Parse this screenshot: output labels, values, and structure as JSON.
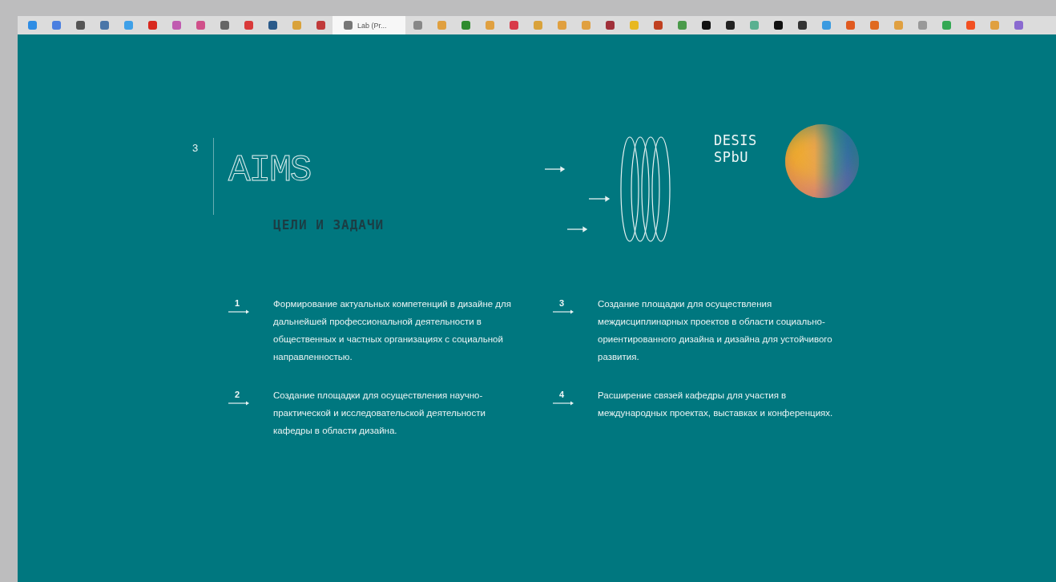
{
  "browser": {
    "tabs": [
      {
        "color": "#2f8de4",
        "selected": false
      },
      {
        "color": "#4a7fe0",
        "selected": false
      },
      {
        "color": "#555555",
        "selected": false
      },
      {
        "color": "#4a76a8",
        "selected": false
      },
      {
        "color": "#3ea0e8",
        "selected": false
      },
      {
        "color": "#d8281e",
        "selected": false
      },
      {
        "color": "#c05bb0",
        "selected": false
      },
      {
        "color": "#d0508a",
        "selected": false
      },
      {
        "color": "#666666",
        "selected": false
      },
      {
        "color": "#d93a3a",
        "selected": false
      },
      {
        "color": "#2a5a8a",
        "selected": false
      },
      {
        "color": "#d9a23a",
        "selected": false
      },
      {
        "color": "#c03a3a",
        "selected": false
      },
      {
        "label": "Lab (Pr...",
        "color": "#777777",
        "selected": true
      },
      {
        "color": "#888888",
        "selected": false
      },
      {
        "color": "#e0a040",
        "selected": false
      },
      {
        "color": "#2e8b2e",
        "selected": false
      },
      {
        "color": "#e0a040",
        "selected": false
      },
      {
        "color": "#d83a4a",
        "selected": false
      },
      {
        "color": "#d9a23a",
        "selected": false
      },
      {
        "color": "#e0a040",
        "selected": false
      },
      {
        "color": "#e0a040",
        "selected": false
      },
      {
        "color": "#a0303a",
        "selected": false
      },
      {
        "color": "#e8b820",
        "selected": false
      },
      {
        "color": "#c04020",
        "selected": false
      },
      {
        "color": "#4a9a4a",
        "selected": false
      },
      {
        "color": "#111111",
        "selected": false
      },
      {
        "color": "#222222",
        "selected": false
      },
      {
        "color": "#5ab090",
        "selected": false
      },
      {
        "color": "#101010",
        "selected": false
      },
      {
        "color": "#333333",
        "selected": false
      },
      {
        "color": "#3a9ae0",
        "selected": false
      },
      {
        "color": "#e05a20",
        "selected": false
      },
      {
        "color": "#e06a20",
        "selected": false
      },
      {
        "color": "#e0a040",
        "selected": false
      },
      {
        "color": "#999999",
        "selected": false
      },
      {
        "color": "#34a853",
        "selected": false
      },
      {
        "color": "#f25022",
        "selected": false
      },
      {
        "color": "#e0a040",
        "selected": false
      },
      {
        "color": "#8a6ad0",
        "selected": false
      }
    ]
  },
  "slide": {
    "number": "3",
    "title": "AIMS",
    "subtitle": "ЦЕЛИ И ЗАДАЧИ",
    "brand": [
      "DESIS",
      "SPbU"
    ],
    "aims": [
      {
        "number": "1",
        "text": "Формирование  актуальных компетенций в дизайне для дальнейшей профессиональной деятельности в общественных и частных организациях с социальной направленностью."
      },
      {
        "number": "3",
        "text": "Создание площадки для осуществления междисциплинарных проектов в области социально-ориентированного дизайна и дизайна для устойчивого развития."
      },
      {
        "number": "2",
        "text": "Создание площадки для осуществления научно-практической и исследовательской деятельности кафедры в области дизайна."
      },
      {
        "number": "4",
        "text": "Расширение связей кафедры для участия в международных проектах, выставках и конференциях."
      }
    ]
  }
}
